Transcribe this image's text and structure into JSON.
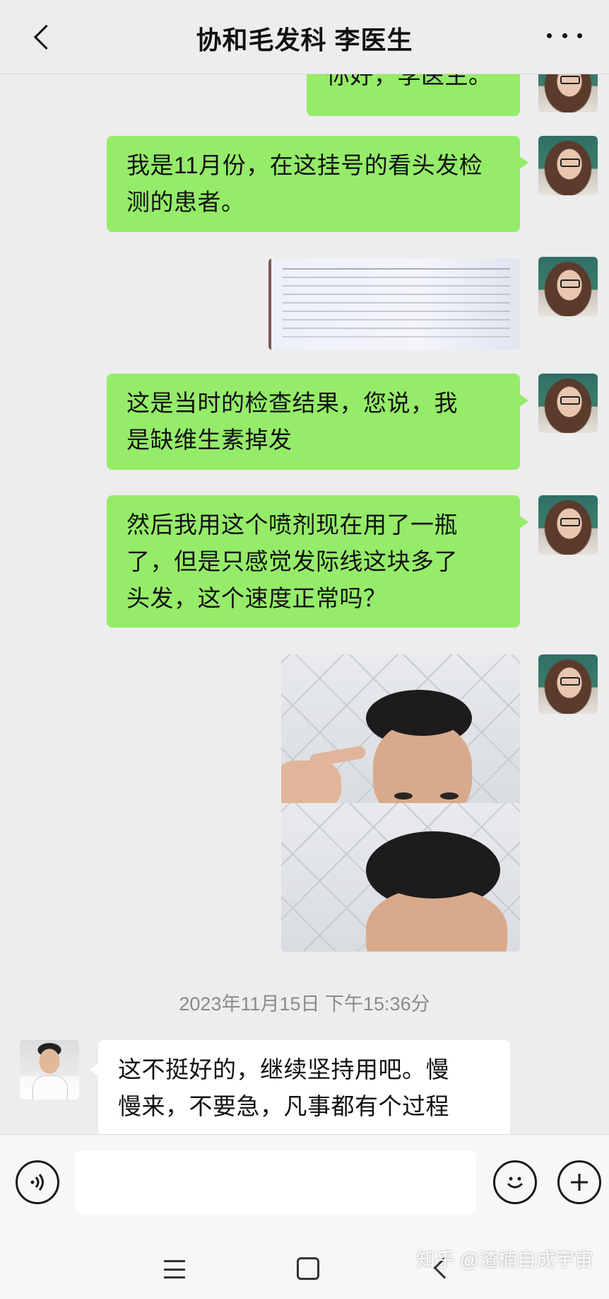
{
  "header": {
    "title": "协和毛发科 李医生",
    "back_icon": "chevron-left-icon",
    "more_icon": "more-horizontal-icon"
  },
  "messages": [
    {
      "sender": "me",
      "type": "text",
      "text": "你好，李医生。"
    },
    {
      "sender": "me",
      "type": "text",
      "lines": [
        "我是11月份，在这挂号的看头发检",
        "测的患者。"
      ]
    },
    {
      "sender": "me",
      "type": "image",
      "content": "lab-report-photo"
    },
    {
      "sender": "me",
      "type": "text",
      "lines": [
        "这是当时的检查结果，您说，我",
        "是缺维生素掉发"
      ]
    },
    {
      "sender": "me",
      "type": "text",
      "lines": [
        "然后我用这个喷剂现在用了一瓶",
        "了，但是只感觉发际线这块多了",
        "头发，这个速度正常吗？"
      ]
    },
    {
      "sender": "me",
      "type": "image",
      "content": "hairline-selfie-photos"
    },
    {
      "sender": "doctor",
      "type": "text",
      "lines": [
        "这不挺好的，继续坚持用吧。慢",
        "慢来，不要急，凡事都有个过程"
      ]
    }
  ],
  "timestamp": "2023年11月15日 下午15:36分",
  "input_bar": {
    "voice_icon": "voice-icon",
    "input_value": "",
    "emoji_icon": "emoji-icon",
    "add_icon": "plus-icon"
  },
  "navbar": {
    "menu_icon": "menu-icon",
    "home_icon": "home-icon",
    "back_icon": "back-icon"
  },
  "watermark": "知乎 @渣楠自成宇宙",
  "colors": {
    "my_bubble": "#95ec69",
    "doctor_bubble": "#ffffff",
    "background": "#ededed"
  }
}
